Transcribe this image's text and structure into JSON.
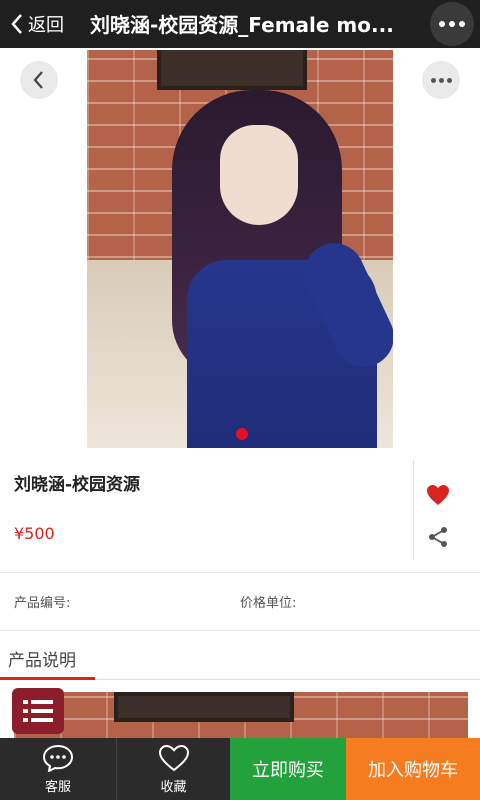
{
  "header": {
    "back_label": "返回",
    "title": "刘晓涵-校园资源_Female mo..."
  },
  "product": {
    "name": "刘晓涵-校园资源",
    "price": "¥500",
    "code_label": "产品编号:",
    "unit_label": "价格单位:"
  },
  "description": {
    "tab_label": "产品说明"
  },
  "bottom_bar": {
    "service_label": "客服",
    "collect_label": "收藏",
    "buy_now_label": "立即购买",
    "add_cart_label": "加入购物车"
  },
  "colors": {
    "accent_red": "#d9231f",
    "buy_green": "#23a23b",
    "cart_orange": "#f57c1f",
    "bar_dark": "#2b2b2b"
  },
  "icons": {
    "back": "chevron-left-icon",
    "more": "more-dots-icon",
    "favorite": "heart-icon",
    "share": "share-icon",
    "list": "list-icon",
    "service": "chat-bubble-icon",
    "collect": "heart-outline-icon"
  }
}
